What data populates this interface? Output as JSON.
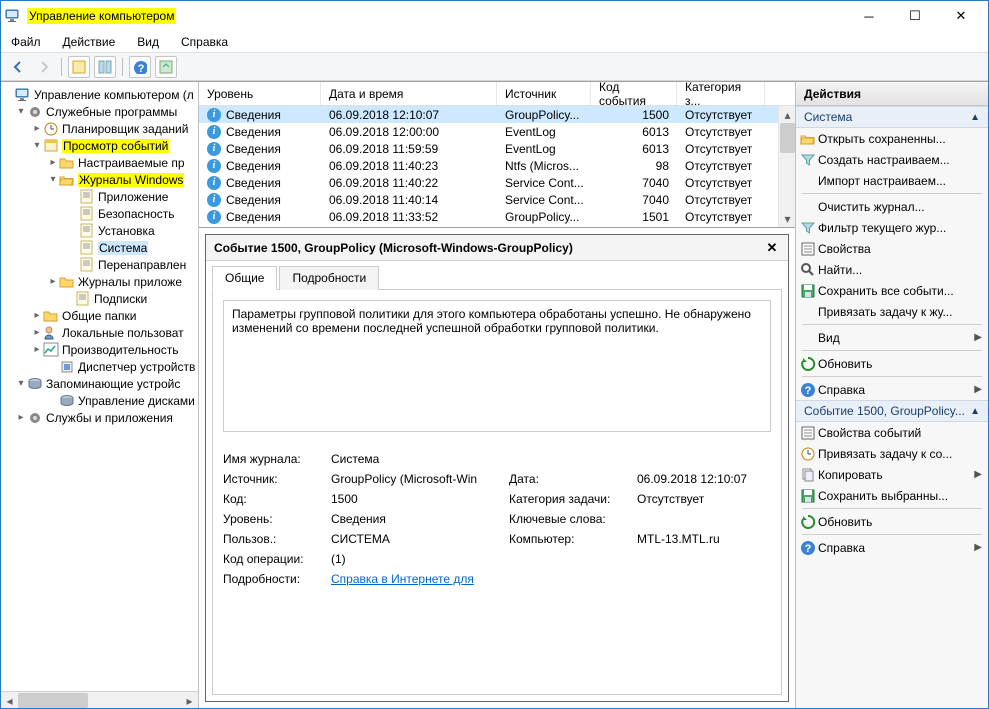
{
  "titlebar": {
    "title": "Управление компьютером"
  },
  "menu": {
    "file": "Файл",
    "action": "Действие",
    "view": "Вид",
    "help": "Справка"
  },
  "tree": {
    "root": "Управление компьютером (л",
    "tools": "Служебные программы",
    "scheduler": "Планировщик заданий",
    "eventviewer": "Просмотр событий",
    "customviews": "Настраиваемые пр",
    "winlogs": "Журналы Windows",
    "app": "Приложение",
    "security": "Безопасность",
    "setup": "Установка",
    "system": "Система",
    "forwarded": "Перенаправлен",
    "applogs": "Журналы приложе",
    "subs": "Подписки",
    "shared": "Общие папки",
    "users": "Локальные пользоват",
    "perf": "Производительность",
    "devmgr": "Диспетчер устройств",
    "storage": "Запоминающие устройс",
    "diskmgr": "Управление дисками",
    "services": "Службы и приложения"
  },
  "columns": {
    "level": "Уровень",
    "datetime": "Дата и время",
    "source": "Источник",
    "eventid": "Код события",
    "category": "Категория з..."
  },
  "rows": [
    {
      "level": "Сведения",
      "dt": "06.09.2018 12:10:07",
      "src": "GroupPolicy...",
      "id": "1500",
      "cat": "Отсутствует"
    },
    {
      "level": "Сведения",
      "dt": "06.09.2018 12:00:00",
      "src": "EventLog",
      "id": "6013",
      "cat": "Отсутствует"
    },
    {
      "level": "Сведения",
      "dt": "06.09.2018 11:59:59",
      "src": "EventLog",
      "id": "6013",
      "cat": "Отсутствует"
    },
    {
      "level": "Сведения",
      "dt": "06.09.2018 11:40:23",
      "src": "Ntfs (Micros...",
      "id": "98",
      "cat": "Отсутствует"
    },
    {
      "level": "Сведения",
      "dt": "06.09.2018 11:40:22",
      "src": "Service Cont...",
      "id": "7040",
      "cat": "Отсутствует"
    },
    {
      "level": "Сведения",
      "dt": "06.09.2018 11:40:14",
      "src": "Service Cont...",
      "id": "7040",
      "cat": "Отсутствует"
    },
    {
      "level": "Сведения",
      "dt": "06.09.2018 11:33:52",
      "src": "GroupPolicy...",
      "id": "1501",
      "cat": "Отсутствует"
    }
  ],
  "detail": {
    "header": "Событие 1500, GroupPolicy (Microsoft-Windows-GroupPolicy)",
    "tab_general": "Общие",
    "tab_details": "Подробности",
    "description": "Параметры групповой политики для этого компьютера обработаны успешно. Не обнаружено изменений со времени последней успешной обработки групповой политики.",
    "k_logname": "Имя журнала:",
    "v_logname": "Система",
    "k_source": "Источник:",
    "v_source": "GroupPolicy (Microsoft-Win",
    "k_date": "Дата:",
    "v_date": "06.09.2018 12:10:07",
    "k_id": "Код:",
    "v_id": "1500",
    "k_cat": "Категория задачи:",
    "v_cat": "Отсутствует",
    "k_level": "Уровень:",
    "v_level": "Сведения",
    "k_keywords": "Ключевые слова:",
    "v_keywords": "",
    "k_user": "Пользов.:",
    "v_user": "СИСТЕМА",
    "k_computer": "Компьютер:",
    "v_computer": "MTL-13.MTL.ru",
    "k_opcode": "Код операции:",
    "v_opcode": "(1)",
    "k_more": "Подробности:",
    "v_more": "Справка в Интернете для "
  },
  "actions": {
    "title": "Действия",
    "section1": "Система",
    "open_saved": "Открыть сохраненны...",
    "create_custom": "Создать настраиваем...",
    "import_custom": "Импорт настраиваем...",
    "clear_log": "Очистить журнал...",
    "filter_log": "Фильтр текущего жур...",
    "properties": "Свойства",
    "find": "Найти...",
    "save_all": "Сохранить все событи...",
    "attach_task": "Привязать задачу к жу...",
    "view": "Вид",
    "refresh": "Обновить",
    "help": "Справка",
    "section2": "Событие 1500, GroupPolicy...",
    "event_props": "Свойства событий",
    "attach_task2": "Привязать задачу к со...",
    "copy": "Копировать",
    "save_selected": "Сохранить выбранны...",
    "refresh2": "Обновить",
    "help2": "Справка"
  }
}
